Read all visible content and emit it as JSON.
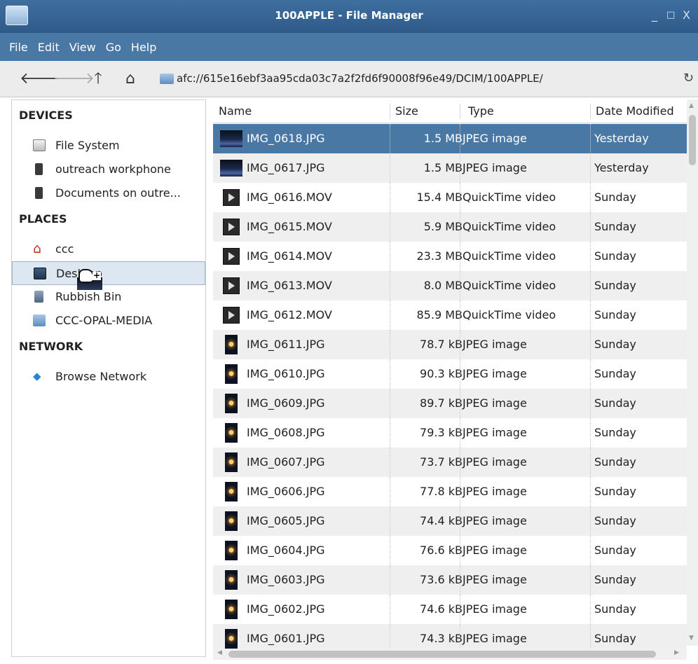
{
  "window": {
    "title": "100APPLE - File Manager",
    "minimize": "_",
    "maximize": "□",
    "close": "X"
  },
  "menubar": [
    "File",
    "Edit",
    "View",
    "Go",
    "Help"
  ],
  "toolbar": {
    "back_icon": "back-arrow-icon",
    "forward_icon": "forward-arrow-icon",
    "up_icon": "up-arrow-icon",
    "home_icon": "home-icon",
    "path": "afc://615e16ebf3aa95cda03c7a2f2fd6f90008f96e49/DCIM/100APPLE/",
    "reload_icon": "reload-icon"
  },
  "sidebar": {
    "devices_heading": "DEVICES",
    "devices": [
      {
        "label": "File System",
        "icon": "drive-icon"
      },
      {
        "label": "outreach workphone",
        "icon": "phone-icon"
      },
      {
        "label": "Documents on outre...",
        "icon": "phone-icon"
      }
    ],
    "places_heading": "PLACES",
    "places": [
      {
        "label": "ccc",
        "icon": "home-icon"
      },
      {
        "label": "Desktop",
        "icon": "desktop-icon"
      },
      {
        "label": "Rubbish Bin",
        "icon": "trash-icon"
      },
      {
        "label": "CCC-OPAL-MEDIA",
        "icon": "folder-icon"
      }
    ],
    "network_heading": "NETWORK",
    "network": [
      {
        "label": "Browse Network",
        "icon": "wifi-icon"
      }
    ]
  },
  "filelist": {
    "columns": [
      "Name",
      "Size",
      "Type",
      "Date Modified"
    ],
    "rows": [
      {
        "name": "IMG_0618.JPG",
        "size": "1.5 MB",
        "type": "JPEG image",
        "date": "Yesterday",
        "kind": "photo-night",
        "selected": true
      },
      {
        "name": "IMG_0617.JPG",
        "size": "1.5 MB",
        "type": "JPEG image",
        "date": "Yesterday",
        "kind": "photo-night"
      },
      {
        "name": "IMG_0616.MOV",
        "size": "15.4 MB",
        "type": "QuickTime video",
        "date": "Sunday",
        "kind": "video"
      },
      {
        "name": "IMG_0615.MOV",
        "size": "5.9 MB",
        "type": "QuickTime video",
        "date": "Sunday",
        "kind": "video"
      },
      {
        "name": "IMG_0614.MOV",
        "size": "23.3 MB",
        "type": "QuickTime video",
        "date": "Sunday",
        "kind": "video"
      },
      {
        "name": "IMG_0613.MOV",
        "size": "8.0 MB",
        "type": "QuickTime video",
        "date": "Sunday",
        "kind": "video"
      },
      {
        "name": "IMG_0612.MOV",
        "size": "85.9 MB",
        "type": "QuickTime video",
        "date": "Sunday",
        "kind": "video"
      },
      {
        "name": "IMG_0611.JPG",
        "size": "78.7 kB",
        "type": "JPEG image",
        "date": "Sunday",
        "kind": "photo-star"
      },
      {
        "name": "IMG_0610.JPG",
        "size": "90.3 kB",
        "type": "JPEG image",
        "date": "Sunday",
        "kind": "photo-star"
      },
      {
        "name": "IMG_0609.JPG",
        "size": "89.7 kB",
        "type": "JPEG image",
        "date": "Sunday",
        "kind": "photo-star"
      },
      {
        "name": "IMG_0608.JPG",
        "size": "79.3 kB",
        "type": "JPEG image",
        "date": "Sunday",
        "kind": "photo-star"
      },
      {
        "name": "IMG_0607.JPG",
        "size": "73.7 kB",
        "type": "JPEG image",
        "date": "Sunday",
        "kind": "photo-star"
      },
      {
        "name": "IMG_0606.JPG",
        "size": "77.8 kB",
        "type": "JPEG image",
        "date": "Sunday",
        "kind": "photo-star"
      },
      {
        "name": "IMG_0605.JPG",
        "size": "74.4 kB",
        "type": "JPEG image",
        "date": "Sunday",
        "kind": "photo-star"
      },
      {
        "name": "IMG_0604.JPG",
        "size": "76.6 kB",
        "type": "JPEG image",
        "date": "Sunday",
        "kind": "photo-star"
      },
      {
        "name": "IMG_0603.JPG",
        "size": "73.6 kB",
        "type": "JPEG image",
        "date": "Sunday",
        "kind": "photo-star"
      },
      {
        "name": "IMG_0602.JPG",
        "size": "74.6 kB",
        "type": "JPEG image",
        "date": "Sunday",
        "kind": "photo-star"
      },
      {
        "name": "IMG_0601.JPG",
        "size": "74.3 kB",
        "type": "JPEG image",
        "date": "Sunday",
        "kind": "photo-star"
      }
    ]
  },
  "colors": {
    "titlebar": "#3f6fa0",
    "menubar": "#4a78a5",
    "selection": "#4a78a5",
    "row_alt": "#efefef"
  }
}
